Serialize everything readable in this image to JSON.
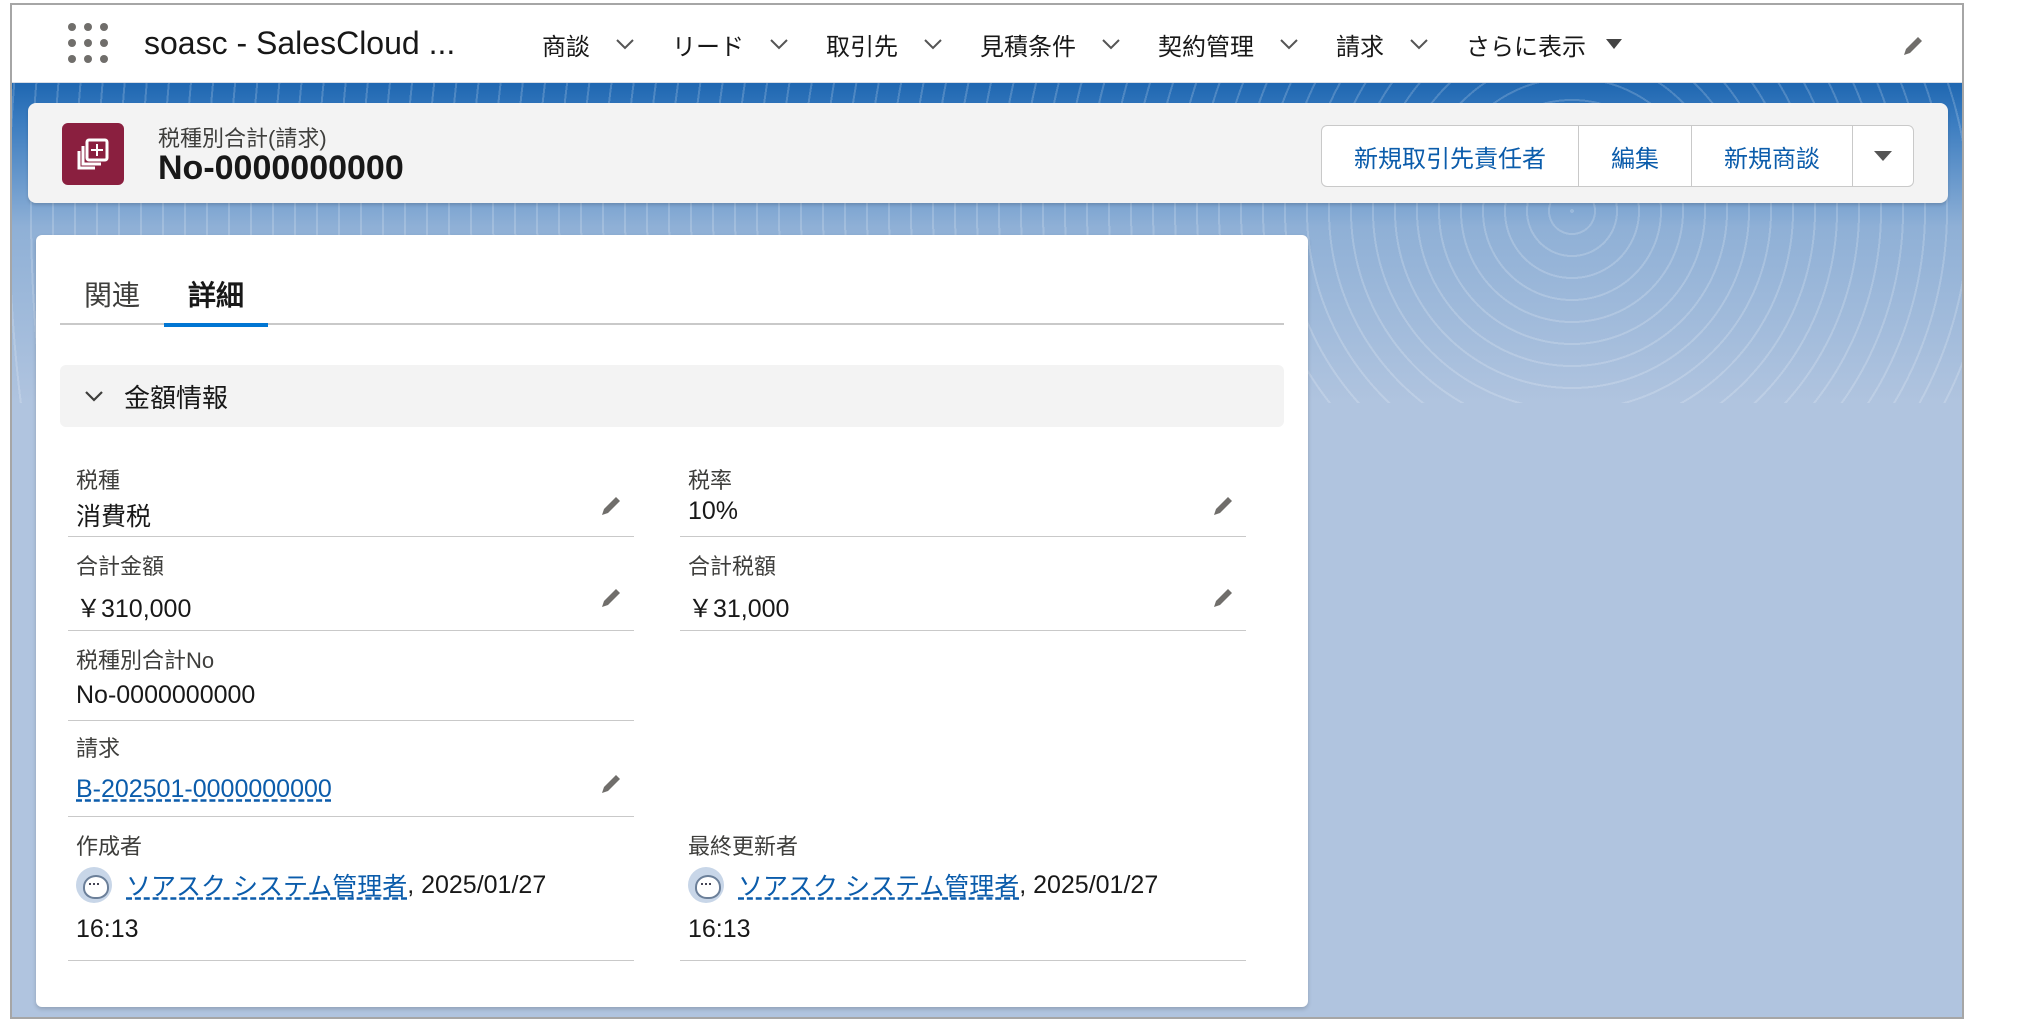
{
  "nav": {
    "app_name": "soasc - SalesCloud ...",
    "items": [
      {
        "label": "商談"
      },
      {
        "label": "リード"
      },
      {
        "label": "取引先"
      },
      {
        "label": "見積条件"
      },
      {
        "label": "契約管理"
      },
      {
        "label": "請求"
      }
    ],
    "more_label": "さらに表示"
  },
  "record": {
    "object_type": "税種別合計(請求)",
    "name": "No-0000000000",
    "icon_color": "#8a1f3f",
    "actions": {
      "new_contact": "新規取引先責任者",
      "edit": "編集",
      "new_opportunity": "新規商談"
    }
  },
  "tabs": {
    "related": "関連",
    "details": "詳細",
    "active": "詳細"
  },
  "section": {
    "title": "金額情報"
  },
  "fields": {
    "tax_type": {
      "label": "税種",
      "value": "消費税"
    },
    "tax_rate": {
      "label": "税率",
      "value": "10%"
    },
    "total_amount": {
      "label": "合計金額",
      "value": "￥310,000"
    },
    "total_tax": {
      "label": "合計税額",
      "value": "￥31,000"
    },
    "summary_no": {
      "label": "税種別合計No",
      "value": "No-0000000000"
    },
    "billing": {
      "label": "請求",
      "value": "B-202501-0000000000"
    },
    "created_by": {
      "label": "作成者",
      "user": "ソアスク システム管理者",
      "date": ", 2025/01/27",
      "time": "16:13"
    },
    "modified_by": {
      "label": "最終更新者",
      "user": "ソアスク システム管理者",
      "date": ", 2025/01/27",
      "time": "16:13"
    }
  },
  "colors": {
    "link": "#0b5cab",
    "tab_active": "#0176d3",
    "banner": "#1f67b1"
  }
}
